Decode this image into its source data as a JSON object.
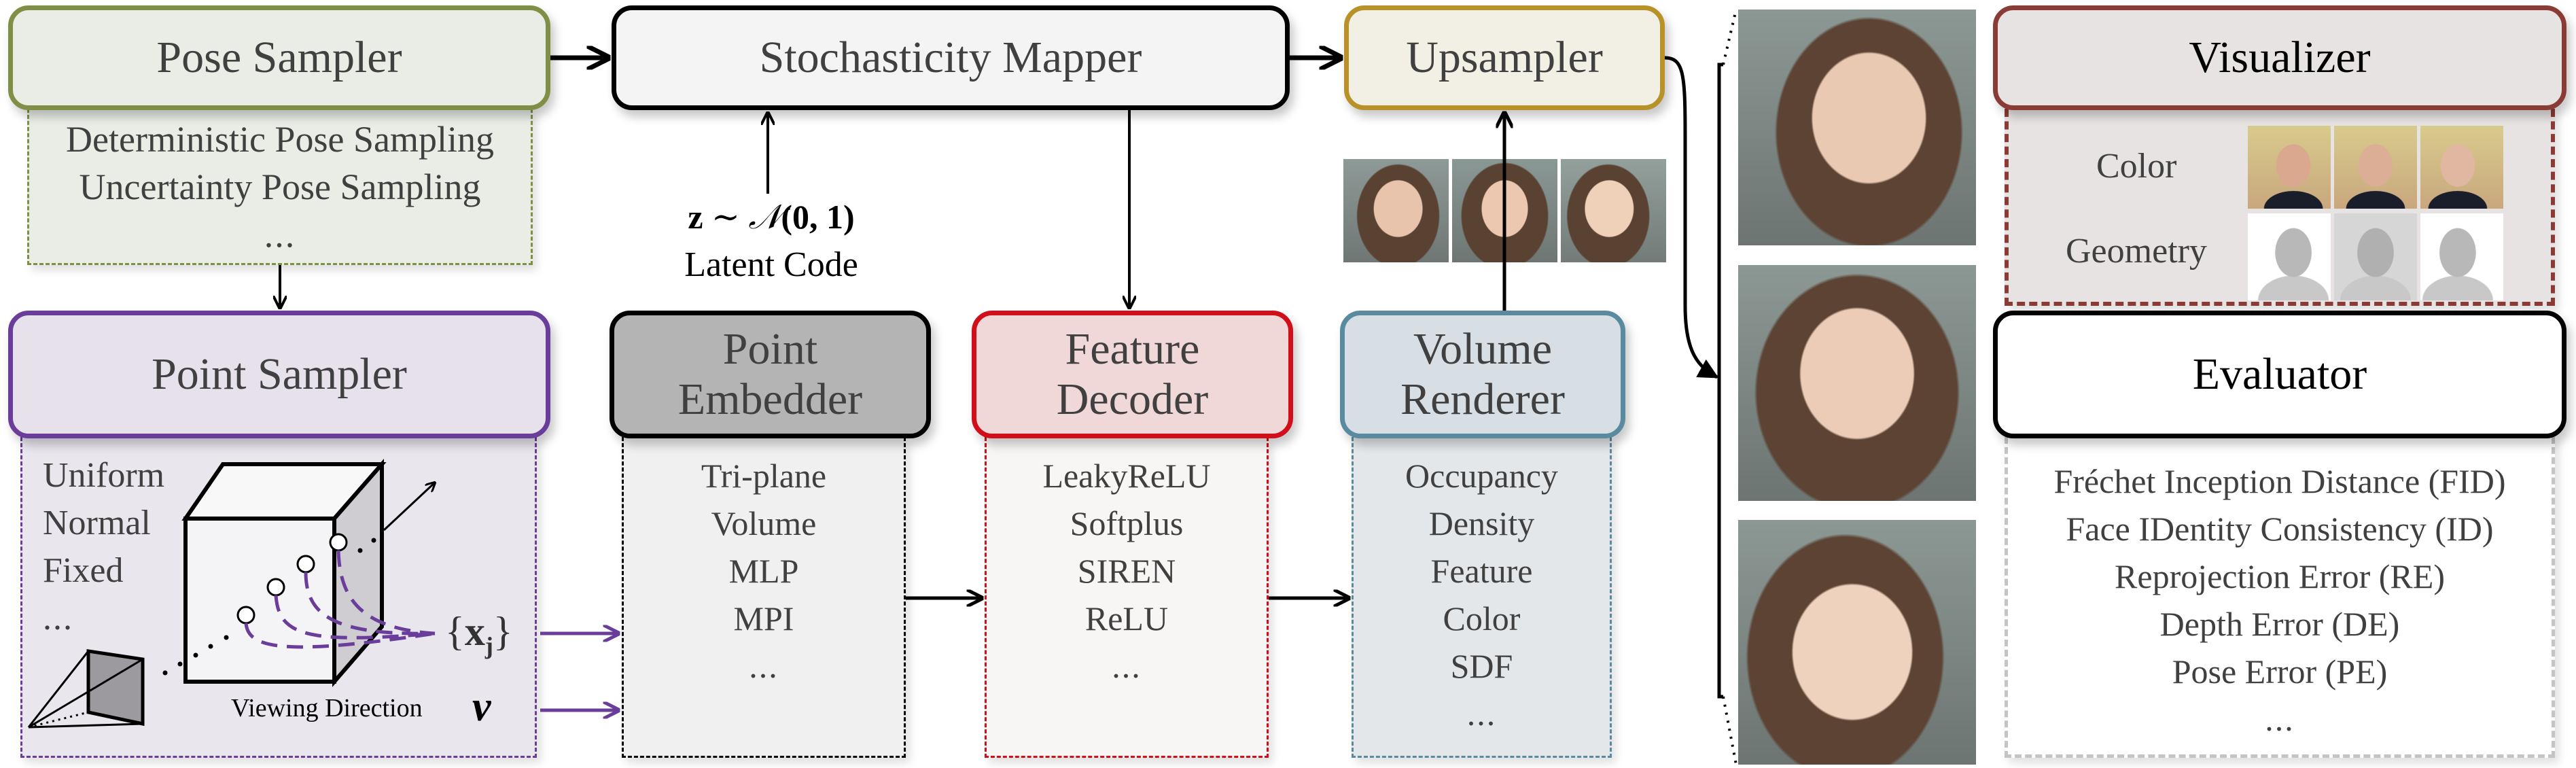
{
  "diagram": {
    "modules": {
      "pose_sampler": {
        "title": "Pose Sampler",
        "items": [
          "Deterministic Pose Sampling",
          "Uncertainty Pose Sampling",
          "..."
        ],
        "color": "#7f9046"
      },
      "stochasticity_mapper": {
        "title": "Stochasticity Mapper",
        "color": "#000000"
      },
      "upsampler": {
        "title": "Upsampler",
        "color": "#b89128"
      },
      "point_sampler": {
        "title": "Point Sampler",
        "items": [
          "Uniform",
          "Normal",
          "Fixed",
          "..."
        ],
        "color": "#6a3d9a",
        "points_label": "{x_j}",
        "points_label_main": "{",
        "points_label_var": "x",
        "points_label_sub": "j",
        "points_label_close": "}",
        "viewing_direction_label": "Viewing Direction",
        "viewing_direction_symbol": "v"
      },
      "point_embedder": {
        "title_line1": "Point",
        "title_line2": "Embedder",
        "items": [
          "Tri-plane",
          "Volume",
          "MLP",
          "MPI",
          "..."
        ],
        "color": "#000000"
      },
      "feature_decoder": {
        "title_line1": "Feature",
        "title_line2": "Decoder",
        "items": [
          "LeakyReLU",
          "Softplus",
          "SIREN",
          "ReLU",
          "..."
        ],
        "color": "#d10f1a"
      },
      "volume_renderer": {
        "title_line1": "Volume",
        "title_line2": "Renderer",
        "items": [
          "Occupancy",
          "Density",
          "Feature",
          "Color",
          "SDF",
          "..."
        ],
        "color": "#5a8aa0"
      },
      "visualizer": {
        "title": "Visualizer",
        "rows": [
          "Color",
          "Geometry"
        ],
        "color": "#8b3b36"
      },
      "evaluator": {
        "title": "Evaluator",
        "items": [
          "Fréchet Inception Distance (FID)",
          "Face IDentity Consistency (ID)",
          "Reprojection Error (RE)",
          "Depth Error (DE)",
          "Pose Error (PE)",
          "..."
        ],
        "color": "#000000"
      }
    },
    "latent": {
      "formula_z": "z",
      "formula_sim": "∼",
      "formula_N": "𝒩",
      "formula_args": "(0, 1)",
      "label": "Latent Code"
    },
    "images": {
      "low_res_faces": [
        "face-left-view",
        "face-front-view",
        "face-right-view"
      ],
      "high_res_faces": [
        "face-right-view",
        "face-front-view",
        "face-left-view"
      ],
      "visualizer_color": [
        "man-left-view",
        "man-front-view",
        "man-right-view"
      ],
      "visualizer_geometry": [
        "mesh-left-view",
        "mesh-front-view",
        "mesh-right-view"
      ]
    }
  }
}
